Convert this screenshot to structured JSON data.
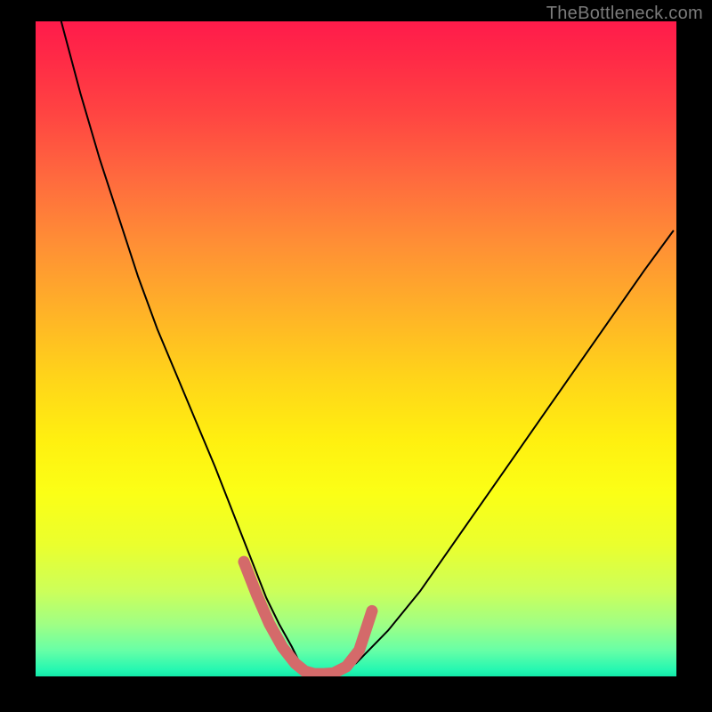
{
  "watermark": "TheBottleneck.com",
  "chart_data": {
    "type": "line",
    "title": "",
    "xlabel": "",
    "ylabel": "",
    "xlim": [
      0,
      100
    ],
    "ylim": [
      0,
      100
    ],
    "grid": false,
    "legend": false,
    "background_gradient": {
      "top": "#ff1b4b",
      "middle": "#fff010",
      "bottom": "#13e8a8"
    },
    "series": [
      {
        "name": "bottleneck-curve",
        "color": "#000000",
        "stroke_width": 2,
        "x": [
          4,
          7,
          10,
          13,
          16,
          19,
          22,
          25,
          28,
          30,
          32,
          34,
          36,
          38,
          40,
          41,
          42,
          43.5,
          46,
          50,
          55,
          60,
          65,
          70,
          75,
          80,
          85,
          90,
          95,
          99.5
        ],
        "y": [
          100,
          89,
          79,
          70,
          61,
          53,
          46,
          39,
          32,
          27,
          22,
          17,
          12,
          8,
          4.5,
          2.5,
          1.2,
          0.5,
          0.5,
          2,
          7,
          13,
          20,
          27,
          34,
          41,
          48,
          55,
          62,
          68
        ]
      },
      {
        "name": "optimal-region-marker",
        "color": "#d46a6a",
        "stroke_width": 13,
        "x": [
          32.5,
          34.5,
          36.5,
          38.5,
          40.5,
          42,
          43.5,
          45,
          46.5,
          48.5,
          50.5,
          51.5,
          52.5
        ],
        "y": [
          17.5,
          12.5,
          8,
          4.5,
          2,
          0.8,
          0.4,
          0.4,
          0.5,
          1.5,
          4,
          7,
          10
        ]
      }
    ]
  }
}
